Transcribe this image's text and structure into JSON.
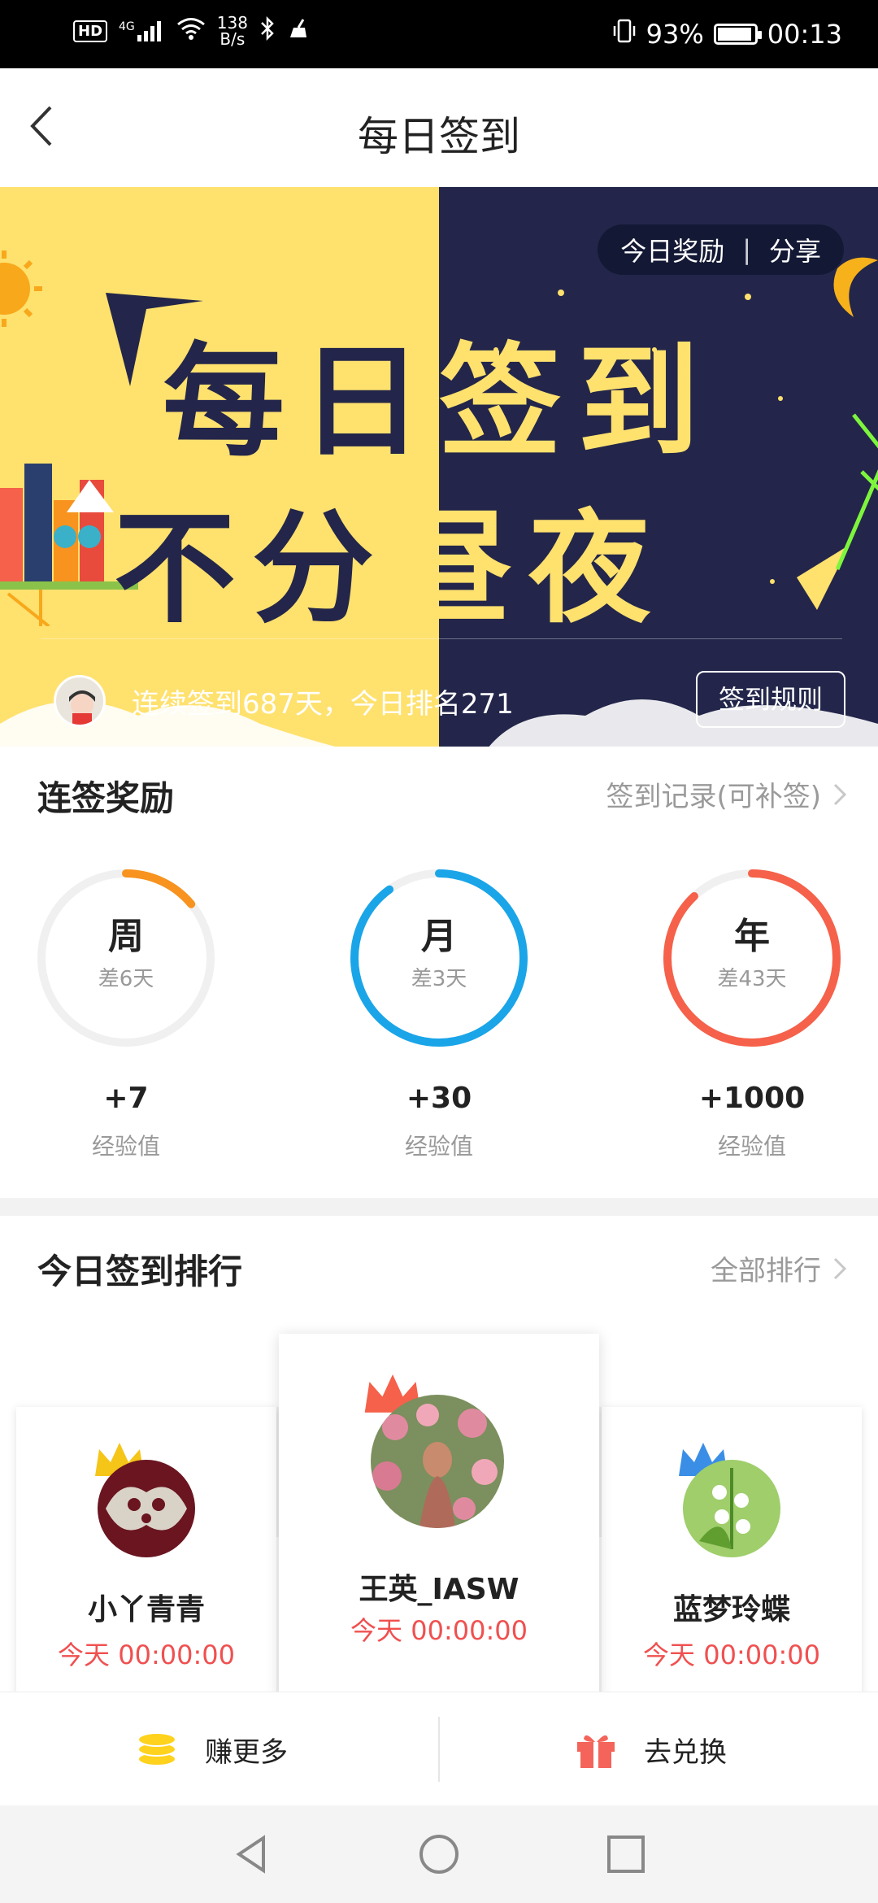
{
  "status_bar": {
    "hd": "HD",
    "network": "4G",
    "speed_value": "138",
    "speed_unit": "B/s",
    "battery": "93%",
    "battery_level": 0.93,
    "time": "00:13"
  },
  "header": {
    "title": "每日签到"
  },
  "banner": {
    "headline_line1": [
      "每",
      "日",
      "签",
      "到"
    ],
    "headline_line2": [
      "不",
      "分",
      "昼",
      "夜"
    ],
    "today_reward": "今日奖励",
    "separator": "|",
    "share": "分享",
    "streak_text": "连续签到687天，今日排名271",
    "rules_button": "签到规则"
  },
  "streak_rewards": {
    "title": "连签奖励",
    "record_link": "签到记录(可补签)",
    "items": [
      {
        "period": "周",
        "remaining": "差6天",
        "reward": "+7",
        "unit": "经验值",
        "progress": 0.14,
        "color": "#f7931e"
      },
      {
        "period": "月",
        "remaining": "差3天",
        "reward": "+30",
        "unit": "经验值",
        "progress": 0.9,
        "color": "#1aa5e8"
      },
      {
        "period": "年",
        "remaining": "差43天",
        "reward": "+1000",
        "unit": "经验值",
        "progress": 0.88,
        "color": "#f5614a"
      }
    ]
  },
  "ranking": {
    "title": "今日签到排行",
    "all_link": "全部排行",
    "entries": [
      {
        "name": "王英_IASW",
        "time": "今天 00:00:00",
        "crown_color": "#f5614a"
      },
      {
        "name": "小丫青青",
        "time": "今天 00:00:00",
        "crown_color": "#f5c518"
      },
      {
        "name": "蓝梦玲蝶",
        "time": "今天 00:00:00",
        "crown_color": "#3a8ee6"
      }
    ]
  },
  "actions": {
    "earn_more": "赚更多",
    "redeem": "去兑换"
  },
  "colors": {
    "accent_red": "#f05050",
    "coin_yellow": "#ffd21e",
    "gift_red": "#f4645a",
    "banner_yellow": "#ffe16e",
    "banner_navy": "#23264a"
  }
}
